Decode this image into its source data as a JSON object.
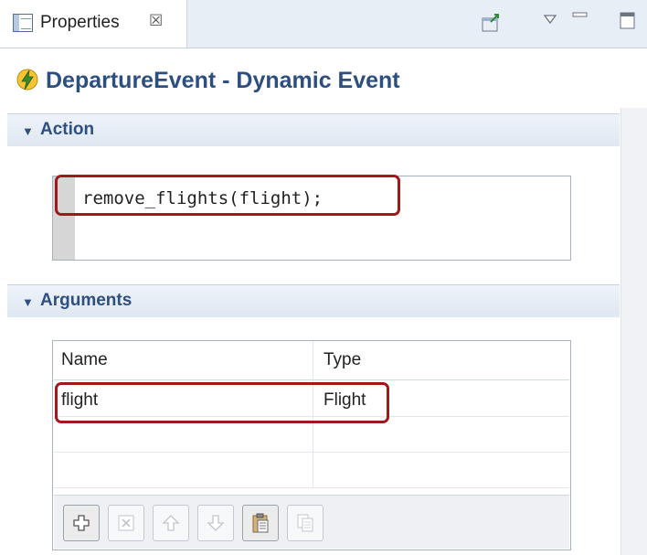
{
  "tab": {
    "label": "Properties",
    "close_glyph": "☒",
    "icon": "properties-view-icon"
  },
  "toolbar": {
    "buttons": [
      "pin-icon",
      "view-menu-icon",
      "minimize-icon",
      "maximize-icon"
    ]
  },
  "header": {
    "title": "DepartureEvent - Dynamic Event",
    "icon": "lightning-event-icon"
  },
  "sections": {
    "action": {
      "label": "Action",
      "code": "remove_flights(flight);"
    },
    "arguments": {
      "label": "Arguments",
      "columns": [
        "Name",
        "Type"
      ],
      "rows": [
        {
          "name": "flight",
          "type": "Flight"
        }
      ]
    }
  },
  "argument_buttons": [
    {
      "name": "add-argument-button",
      "icon": "plus-icon",
      "enabled": true
    },
    {
      "name": "remove-argument-button",
      "icon": "delete-icon",
      "enabled": false
    },
    {
      "name": "move-up-button",
      "icon": "arrow-up-icon",
      "enabled": false
    },
    {
      "name": "move-down-button",
      "icon": "arrow-down-icon",
      "enabled": false
    },
    {
      "name": "paste-button",
      "icon": "paste-icon",
      "enabled": true
    },
    {
      "name": "copy-button",
      "icon": "copy-icon",
      "enabled": false
    }
  ],
  "highlight_color": "#a3161a"
}
